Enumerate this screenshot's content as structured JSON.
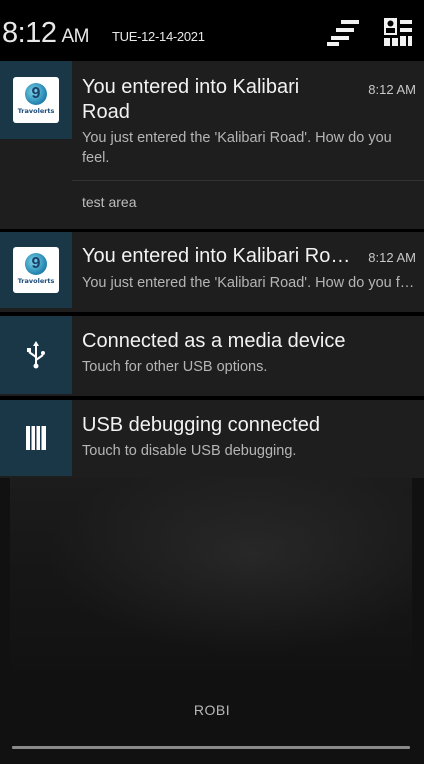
{
  "header": {
    "time": "8:12",
    "ampm": "AM",
    "date": "TUE-12-14-2021",
    "list_icon": "clear-notifications-icon",
    "settings_icon": "quick-settings-icon"
  },
  "notifications": [
    {
      "app": "Travolerts",
      "title": "You entered into Kalibari Road",
      "time": "8:12 AM",
      "body": "You just entered the 'Kalibari Road'. How do you feel.",
      "expanded_text": "test area",
      "icon": "travolerts-logo"
    },
    {
      "app": "Travolerts",
      "title": "You entered into Kalibari Road",
      "time": "8:12 AM",
      "body": "You just entered the 'Kalibari Road'. How do you feel.",
      "icon": "travolerts-logo"
    },
    {
      "title": "Connected as a media device",
      "body": "Touch for other USB options.",
      "icon": "usb-icon"
    },
    {
      "title": "USB debugging connected",
      "body": "Touch to disable USB debugging.",
      "icon": "usb-debugging-icon"
    }
  ],
  "carrier": "ROBI",
  "colors": {
    "icon_box": "#1a3748",
    "notif_bg": "#1e1e1e",
    "background": "#000000"
  }
}
